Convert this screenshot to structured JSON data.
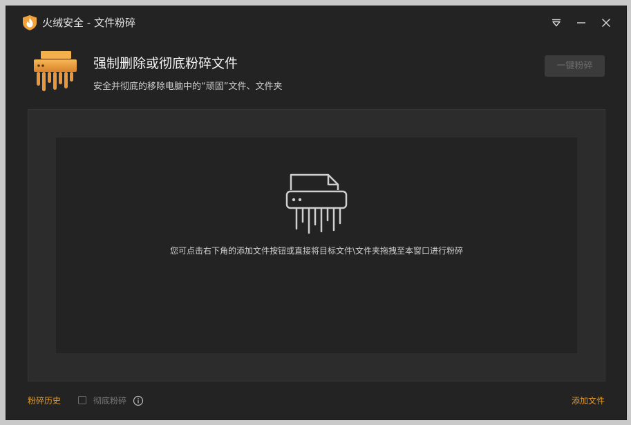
{
  "window": {
    "title": "火绒安全 - 文件粉碎",
    "logo_icon": "huorong-shield-flame-icon",
    "controls": [
      "menu-triangle-icon",
      "minimize-icon",
      "close-icon"
    ]
  },
  "header": {
    "icon": "shredder-icon",
    "title": "强制删除或彻底粉碎文件",
    "subtitle": "安全并彻底的移除电脑中的“顽固”文件、文件夹",
    "shred_button_label": "一键粉碎"
  },
  "drop_zone": {
    "icon": "shredder-outline-icon",
    "hint": "您可点击右下角的添加文件按钮或直接将目标文件\\文件夹拖拽至本窗口进行粉碎"
  },
  "footer": {
    "history_label": "粉碎历史",
    "thorough_checkbox_label": "彻底粉碎",
    "thorough_checked": false,
    "info_icon": "info-icon",
    "add_file_label": "添加文件"
  },
  "colors": {
    "accent": "#e09a2c",
    "background": "#232323",
    "panel": "#2c2c2c"
  }
}
